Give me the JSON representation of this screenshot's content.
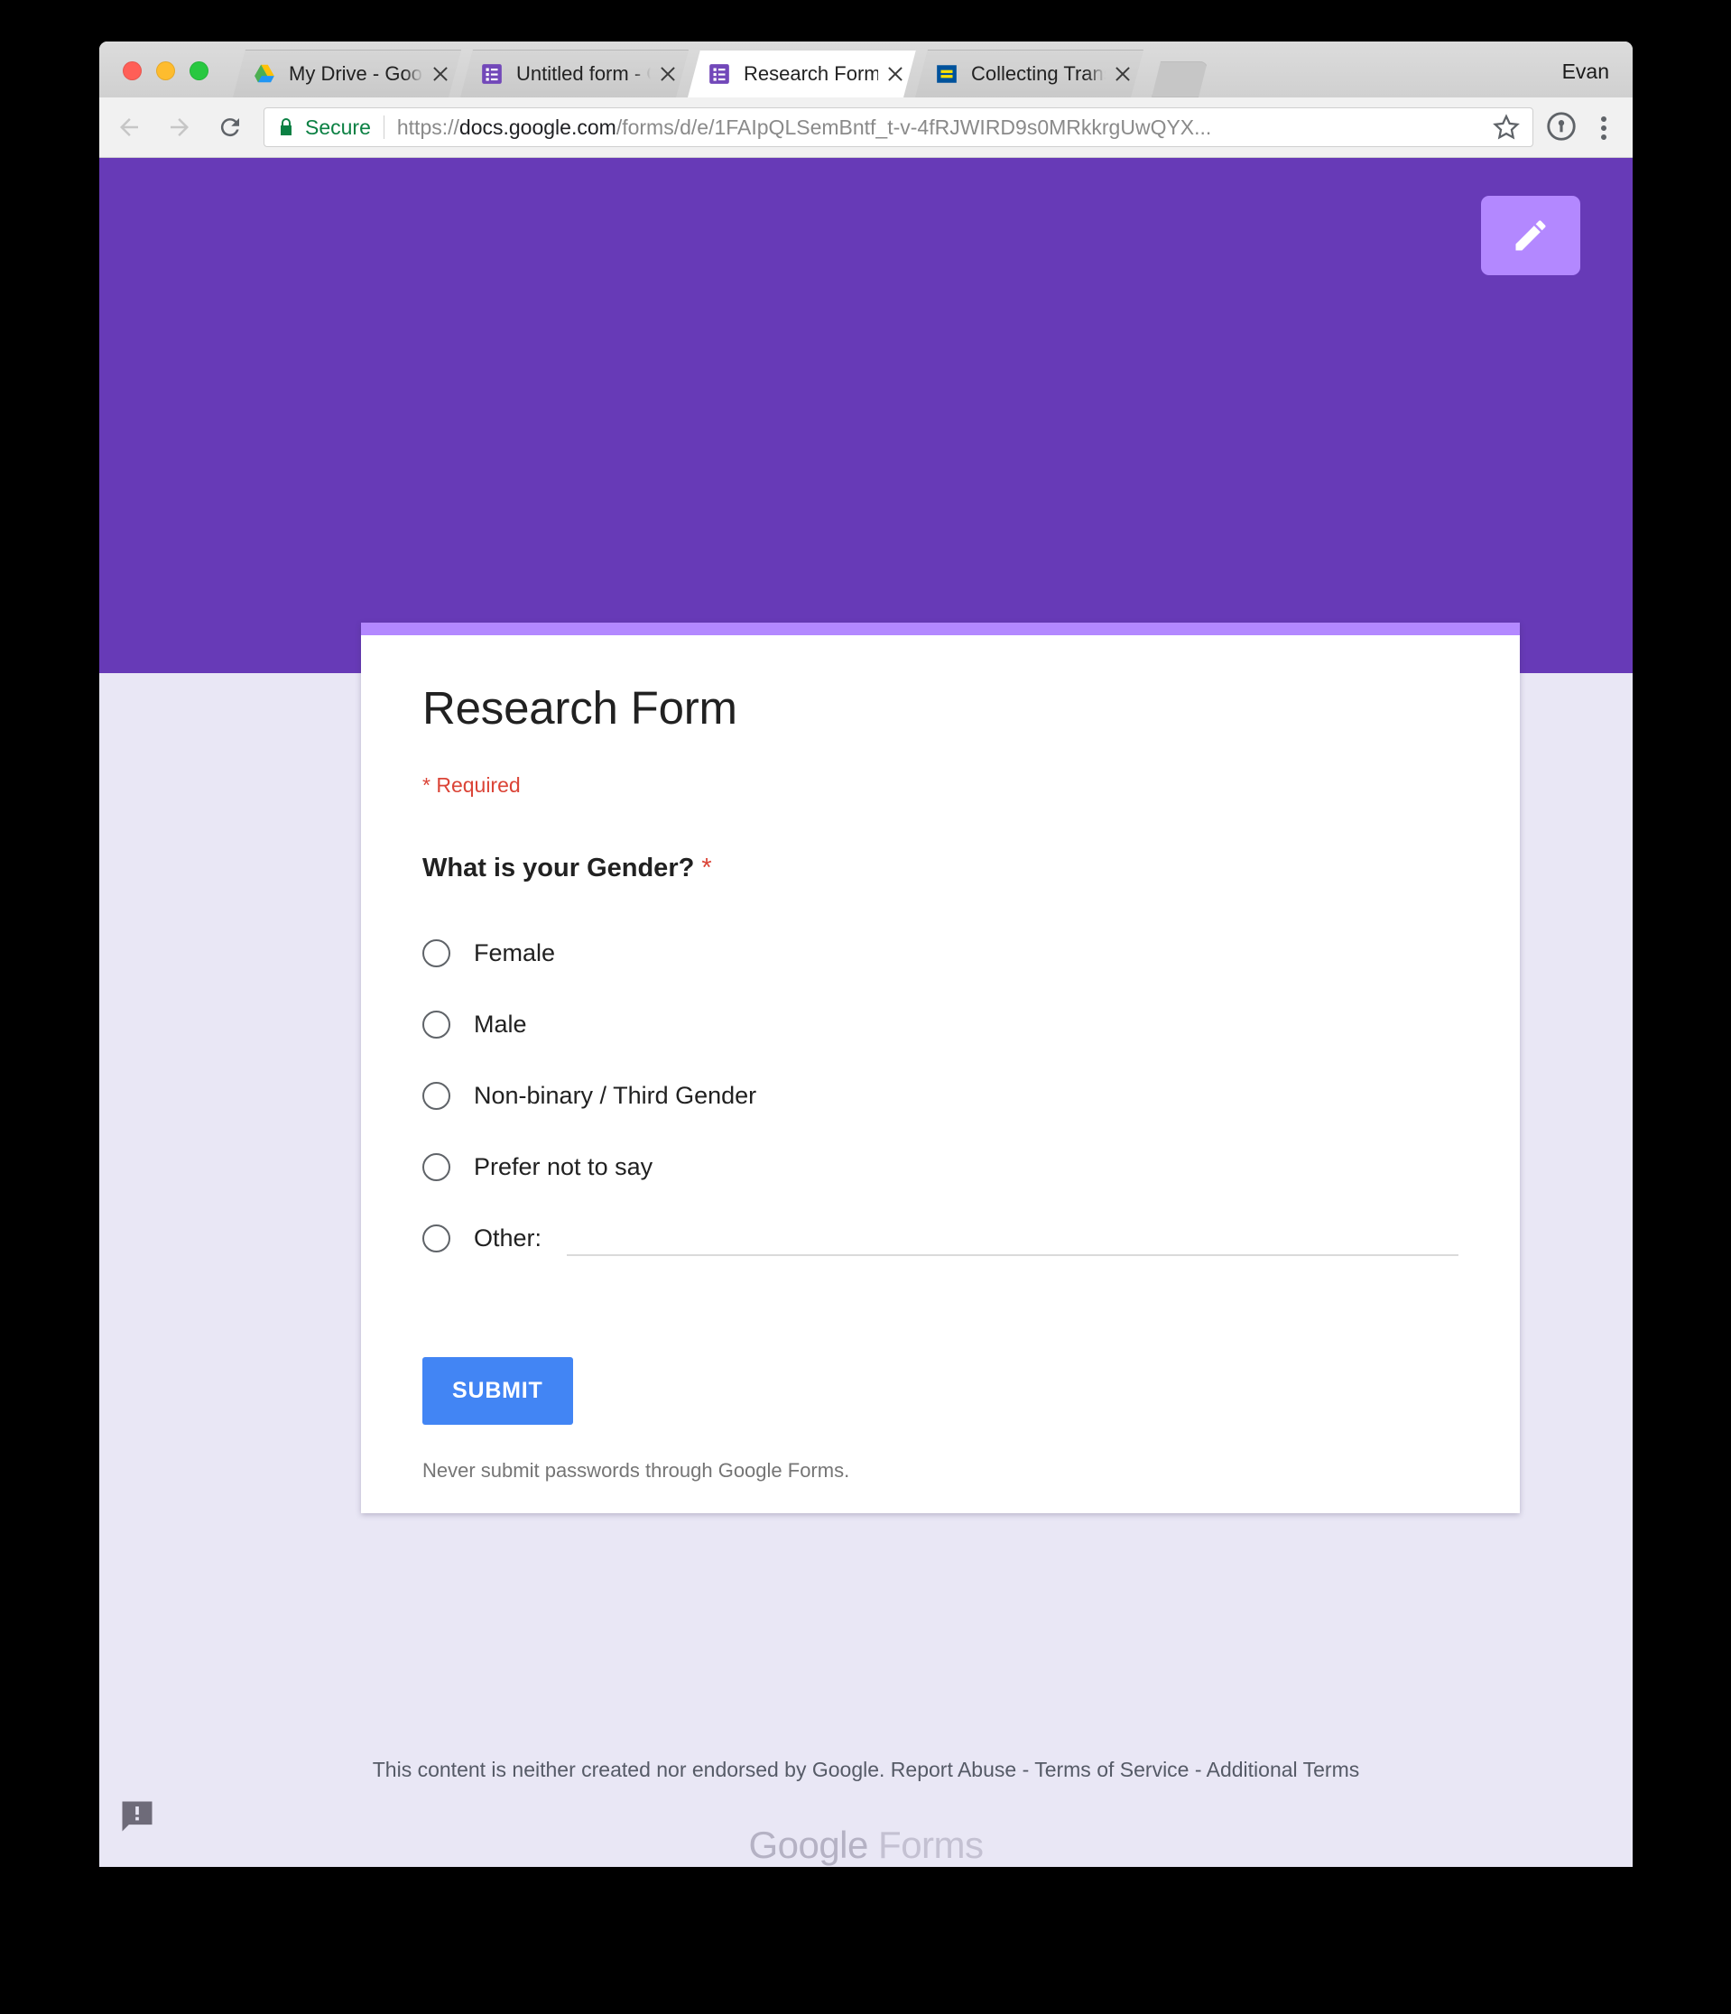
{
  "browser": {
    "profile_name": "Evan",
    "tabs": [
      {
        "title": "My Drive - Google D",
        "favicon": "google-drive-icon",
        "active": false
      },
      {
        "title": "Untitled form - Goog",
        "favicon": "google-forms-icon",
        "active": false
      },
      {
        "title": "Research Form",
        "favicon": "google-forms-icon",
        "active": true
      },
      {
        "title": "Collecting Transgend",
        "favicon": "hrc-equality-icon",
        "active": false
      }
    ],
    "toolbar": {
      "back_icon": "back-arrow-icon",
      "forward_icon": "forward-arrow-icon",
      "reload_icon": "reload-icon",
      "security_label": "Secure",
      "lock_icon": "lock-icon",
      "url_scheme": "https://",
      "url_host": "docs.google.com",
      "url_path": "/forms/d/e/1FAIpQLSemBntf_t-v-4fRJWIRD9s0MRkkrgUwQYX...",
      "star_icon": "bookmark-star-icon",
      "password_manager_icon": "1password-icon",
      "menu_icon": "chrome-menu-icon"
    }
  },
  "page": {
    "header": {
      "background_color": "#673AB7",
      "edit_button_label": "edit-pencil-icon"
    },
    "form": {
      "accent_stripe_color": "#B388FF",
      "title": "Research Form",
      "required_note": "* Required",
      "question": {
        "text": "What is your Gender?",
        "required_marker": "*",
        "options": [
          {
            "label": "Female",
            "selected": false
          },
          {
            "label": "Male",
            "selected": false
          },
          {
            "label": "Non-binary / Third Gender",
            "selected": false
          },
          {
            "label": "Prefer not to say",
            "selected": false
          },
          {
            "label": "Other:",
            "selected": false,
            "has_text_input": true,
            "input_value": ""
          }
        ]
      },
      "submit_label": "SUBMIT",
      "password_note": "Never submit passwords through Google Forms."
    },
    "footer": {
      "disclaimer": "This content is neither created nor endorsed by Google. Report Abuse - Terms of Service - Additional Terms",
      "brand_google": "Google",
      "brand_product": "Forms",
      "feedback_icon": "report-feedback-icon"
    }
  }
}
